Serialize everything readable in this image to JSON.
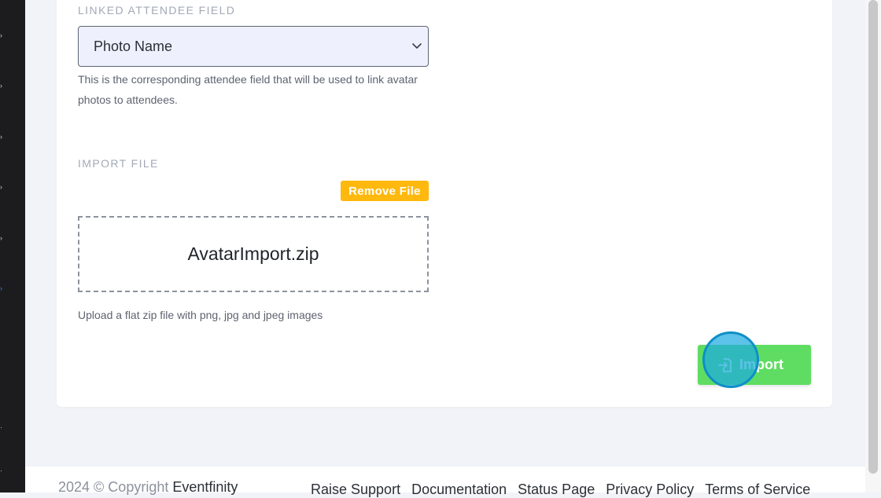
{
  "linked_field": {
    "label": "LINKED ATTENDEE FIELD",
    "selected": "Photo Name",
    "help_line1": "This is the corresponding attendee field that will be used to link avatar",
    "help_line2": "photos to attendees."
  },
  "import_file": {
    "label": "IMPORT FILE",
    "remove_label": "Remove File",
    "filename": "AvatarImport.zip",
    "help": "Upload a flat zip file with png, jpg and jpeg images"
  },
  "actions": {
    "import_label": "Import"
  },
  "footer": {
    "copyright": "2024 © Copyright",
    "brand": "Eventfinity",
    "links": [
      "Raise Support",
      "Documentation",
      "Status Page",
      "Privacy Policy",
      "Terms of Service"
    ]
  },
  "colors": {
    "accent_green": "#5fdd62",
    "warning_yellow": "#ffb80d",
    "sidebar_bg": "#1c1c1e"
  },
  "icons": {
    "select_chevron": "chevron-down-icon",
    "import": "file-import-icon"
  }
}
